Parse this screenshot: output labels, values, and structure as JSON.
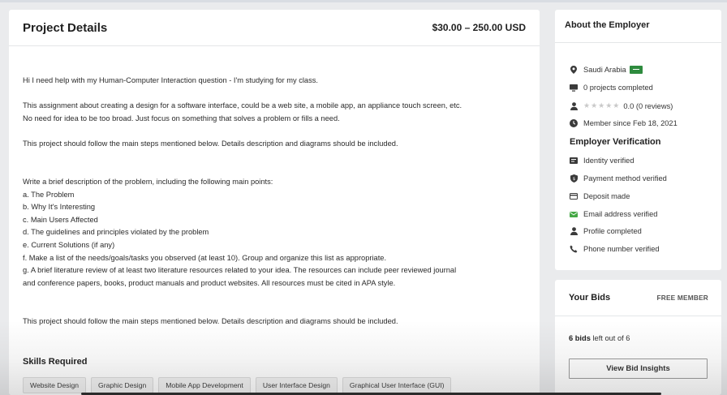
{
  "project": {
    "title": "Project Details",
    "budget": "$30.00 – 250.00 USD",
    "description": [
      "Hi I need help with my Human-Computer Interaction question - I'm studying for my class.",
      "This assignment about creating a design for a software interface, could be a web site, a mobile app, an appliance touch screen, etc.",
      "No need for idea to be too broad. Just focus on something that solves a problem or fills a need.",
      "This project should follow the main steps mentioned below. Details description and diagrams should be included.",
      "Write a brief description of the problem, including the following main points:",
      "a. The Problem",
      "b. Why It's Interesting",
      "c. Main Users Affected",
      "d. The guidelines and principles violated by the problem",
      "e. Current Solutions (if any)",
      "f. Make a list of the needs/goals/tasks you observed (at least 10). Group and organize this list as appropriate.",
      "g. A brief literature review of at least two literature resources related to your idea. The resources can include peer reviewed journal",
      "and conference papers, books, product manuals and product websites. All resources must be cited in APA style.",
      "This project should follow the main steps mentioned below. Details description and diagrams should be included."
    ],
    "skills_title": "Skills Required",
    "skills": [
      "Website Design",
      "Graphic Design",
      "Mobile App Development",
      "User Interface Design",
      "Graphical User Interface (GUI)"
    ]
  },
  "employer": {
    "title": "About the Employer",
    "country": "Saudi Arabia",
    "projects_completed": "0 projects completed",
    "rating": "0.0 (0 reviews)",
    "member_since": "Member since Feb 18, 2021",
    "verification_title": "Employer Verification",
    "verifications": [
      {
        "label": "Identity verified",
        "icon": "id-card-icon",
        "color": "#3a3a3a"
      },
      {
        "label": "Payment method verified",
        "icon": "shield-icon",
        "color": "#3a3a3a"
      },
      {
        "label": "Deposit made",
        "icon": "credit-card-icon",
        "color": "#3a3a3a"
      },
      {
        "label": "Email address verified",
        "icon": "envelope-icon",
        "color": "#45a845"
      },
      {
        "label": "Profile completed",
        "icon": "user-icon",
        "color": "#3a3a3a"
      },
      {
        "label": "Phone number verified",
        "icon": "phone-icon",
        "color": "#3a3a3a"
      }
    ]
  },
  "bids": {
    "title": "Your Bids",
    "membership": "FREE MEMBER",
    "count": "6 bids",
    "left_text": " left out of 6",
    "insights_button": "View Bid Insights"
  }
}
